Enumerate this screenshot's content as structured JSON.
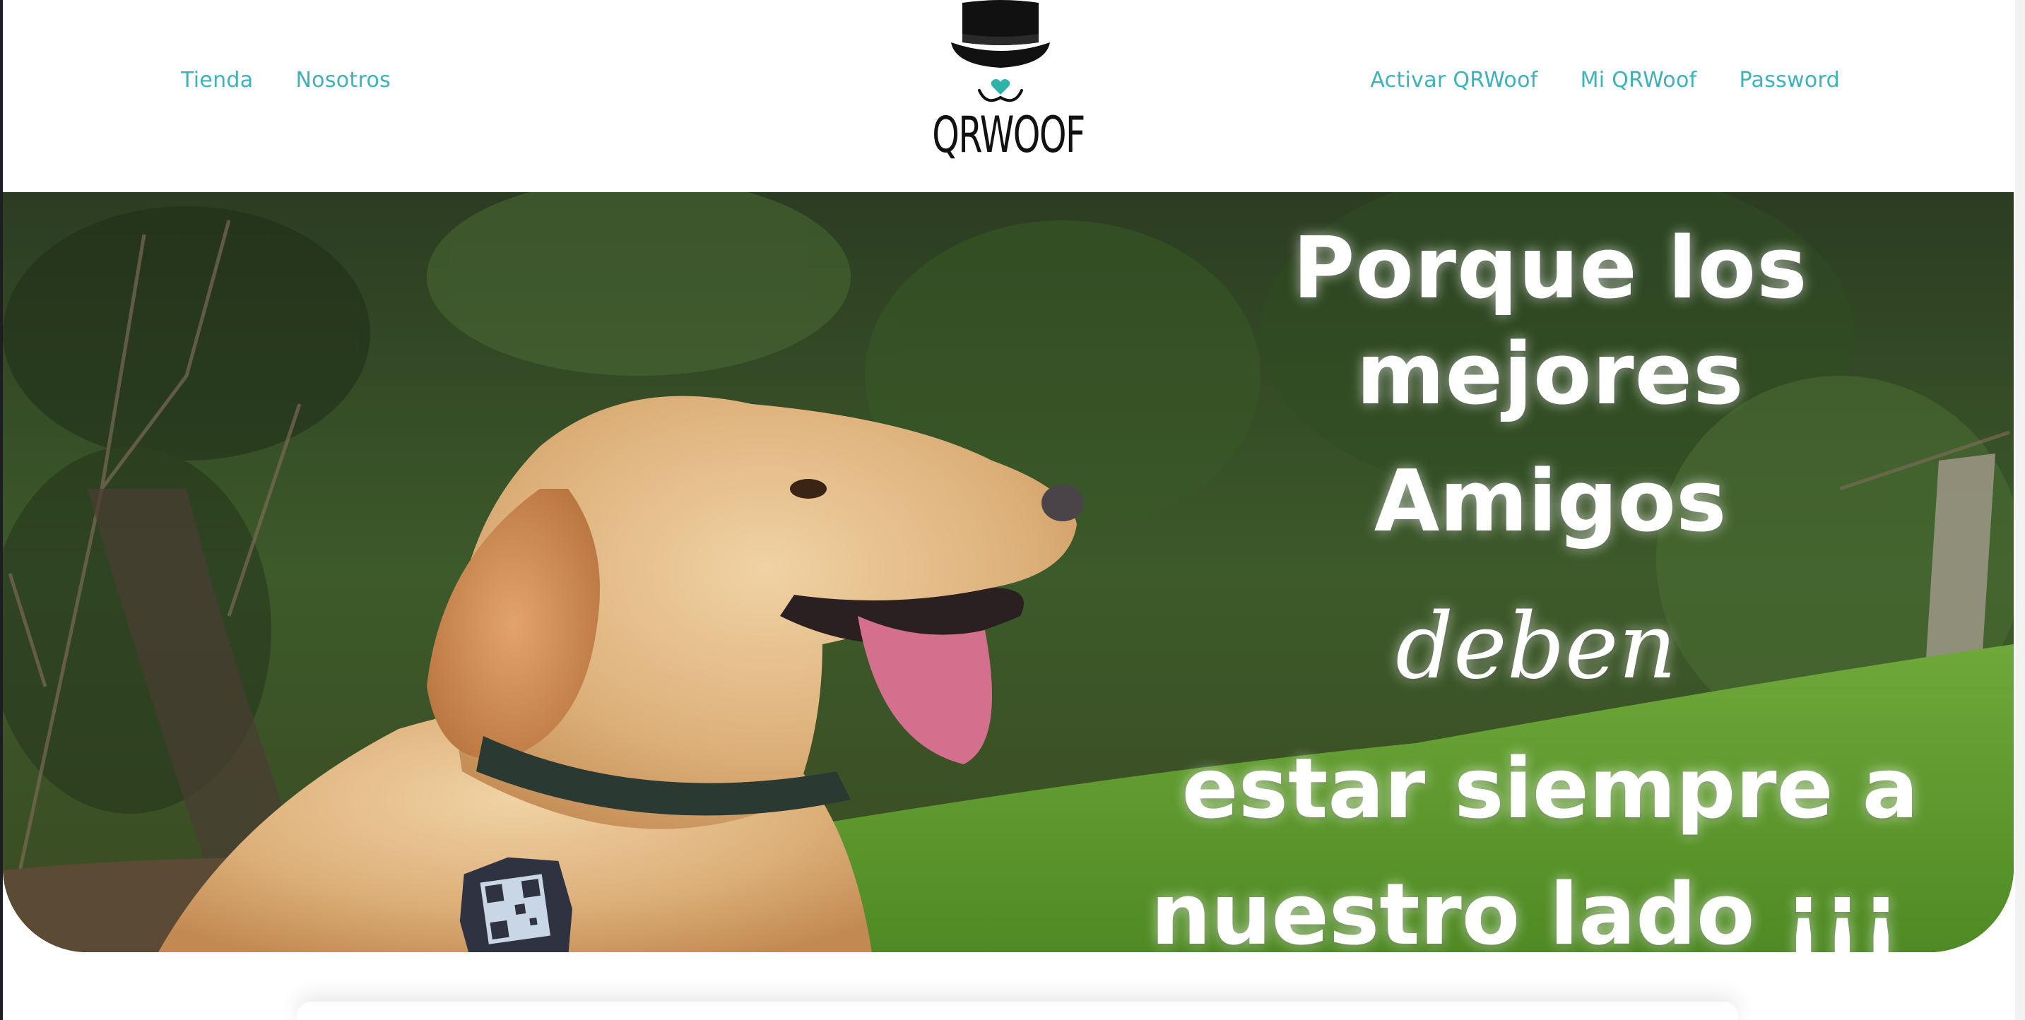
{
  "header": {
    "nav_left": [
      {
        "label": "Tienda"
      },
      {
        "label": "Nosotros"
      }
    ],
    "nav_right": [
      {
        "label": "Activar QRWoof"
      },
      {
        "label": "Mi QRWoof"
      },
      {
        "label": "Password"
      }
    ],
    "logo": {
      "text": "QRWOOF",
      "icon": "top-hat-dog-face-icon"
    }
  },
  "hero": {
    "headline": {
      "line1": "Porque los mejores",
      "line2": "Amigos",
      "line3": "deben",
      "line4": "estar siempre a",
      "line5": "nuestro lado ¡¡¡"
    },
    "image": "golden-retriever-with-qr-tag-photo"
  },
  "colors": {
    "accent": "#3db2bd",
    "logo_dark": "#111111",
    "headline": "#ffffff"
  }
}
